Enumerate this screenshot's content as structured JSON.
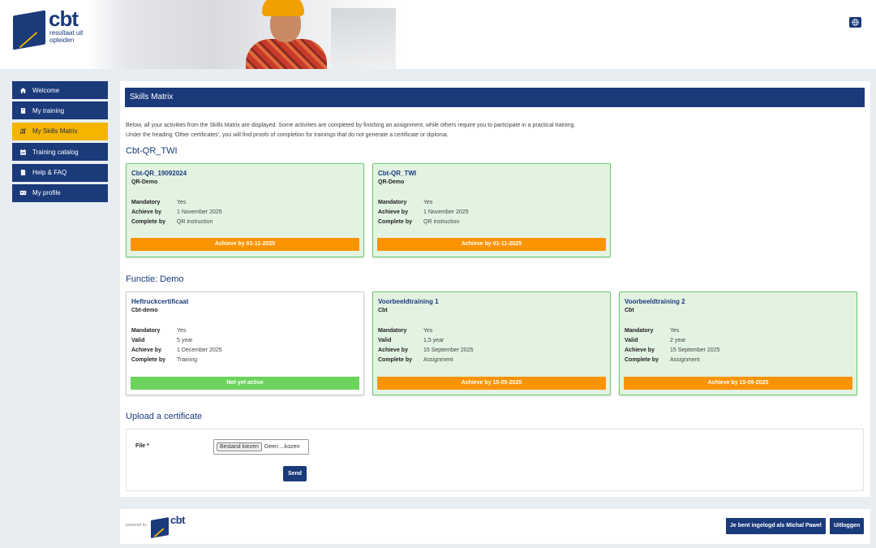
{
  "brand": {
    "logo_text": "cbt",
    "logo_sub": "resultaat uit opleiden",
    "powered_by": "powered by",
    "footer_logo_text": "cbt"
  },
  "sidebar": {
    "items": [
      {
        "label": "Welcome",
        "icon": "home-icon"
      },
      {
        "label": "My training",
        "icon": "book-icon"
      },
      {
        "label": "My Skills Matrix",
        "icon": "chart-icon",
        "active": true
      },
      {
        "label": "Training catalog",
        "icon": "calendar-icon"
      },
      {
        "label": "Help & FAQ",
        "icon": "help-book-icon"
      },
      {
        "label": "My profile",
        "icon": "id-card-icon"
      }
    ]
  },
  "main": {
    "title": "Skills Matrix",
    "intro_line1": "Below, all your activities from the Skills Matrix are displayed. Some activities are completed by finishing an assignment, while others require you to participate in a practical training.",
    "intro_line2": "Under the heading 'Other certificates', you will find proofs of completion for trainings that do not generate a certificate or diploma.",
    "sections": [
      {
        "heading": "Cbt-QR_TWI",
        "cards": [
          {
            "title": "Cbt-QR_19092024",
            "subtitle": "QR-Demo",
            "rows": [
              {
                "k": "Mandatory",
                "v": "Yes"
              },
              {
                "k": "Achieve by",
                "v": "1 November 2025"
              },
              {
                "k": "Complete by",
                "v": "QR instruction"
              }
            ],
            "status": "Achieve by 01-11-2025",
            "status_color": "#fb9400"
          },
          {
            "title": "Cbt-QR_TWI",
            "subtitle": "QR-Demo",
            "rows": [
              {
                "k": "Mandatory",
                "v": "Yes"
              },
              {
                "k": "Achieve by",
                "v": "1 November 2025"
              },
              {
                "k": "Complete by",
                "v": "QR instruction"
              }
            ],
            "status": "Achieve by 01-11-2025",
            "status_color": "#fb9400"
          }
        ]
      },
      {
        "heading": "Functie: Demo",
        "cards": [
          {
            "title": "Heftruckcertificaat",
            "subtitle": "Cbt-demo",
            "rows": [
              {
                "k": "Mandatory",
                "v": "Yes"
              },
              {
                "k": "Valid",
                "v": "5 year"
              },
              {
                "k": "Achieve by",
                "v": "1 December 2025"
              },
              {
                "k": "Complete by",
                "v": "Training"
              }
            ],
            "status": "Not yet active",
            "status_color": "#6cd35c"
          },
          {
            "title": "Voorbeeldtraining 1",
            "subtitle": "Cbt",
            "rows": [
              {
                "k": "Mandatory",
                "v": "Yes"
              },
              {
                "k": "Valid",
                "v": "1,5 year"
              },
              {
                "k": "Achieve by",
                "v": "15 September 2025"
              },
              {
                "k": "Complete by",
                "v": "Assignment"
              }
            ],
            "status": "Achieve by 15-09-2025",
            "status_color": "#fb9400"
          },
          {
            "title": "Voorbeeldtraining 2",
            "subtitle": "Cbt",
            "rows": [
              {
                "k": "Mandatory",
                "v": "Yes"
              },
              {
                "k": "Valid",
                "v": "2 year"
              },
              {
                "k": "Achieve by",
                "v": "15 September 2025"
              },
              {
                "k": "Complete by",
                "v": "Assignment"
              }
            ],
            "status": "Achieve by 15-09-2025",
            "status_color": "#fb9400"
          }
        ]
      }
    ],
    "upload": {
      "heading": "Upload a certificate",
      "file_label": "File *",
      "file_button": "Bestand kiezen",
      "file_status": "Geen ...kozen",
      "send_label": "Send"
    }
  },
  "footer": {
    "user_label": "Je bent ingelogd als Michal Pawel",
    "logout_label": "Uitloggen"
  },
  "colors": {
    "brand_blue": "#1a3a7a",
    "active_yellow": "#f5b400",
    "status_orange": "#fb9400",
    "status_green": "#6cd35c",
    "card_green_bg": "#e3f3e2"
  }
}
